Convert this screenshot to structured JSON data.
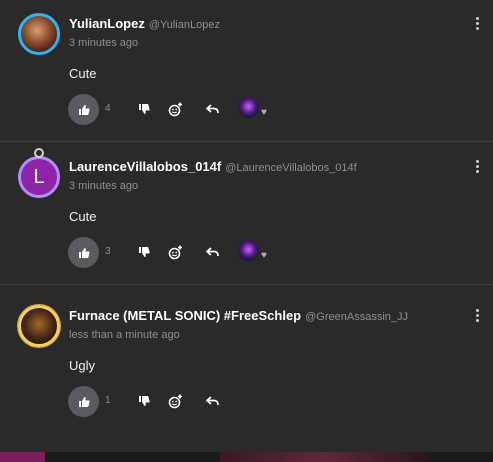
{
  "comments": [
    {
      "name": "YulianLopez",
      "handle": "@YulianLopez",
      "time": "3 minutes ago",
      "text": "Cute",
      "likes": "4",
      "has_reactor": true
    },
    {
      "name": "LaurenceVillalobos_014f",
      "handle": "@LaurenceVillalobos_014f",
      "time": "3 minutes ago",
      "text": "Cute",
      "likes": "3",
      "avatar_letter": "L",
      "has_reactor": true
    },
    {
      "name": "Furnace (METAL SONIC) #FreeSchlep",
      "handle": "@GreenAssassin_JJ",
      "time": "less than a minute ago",
      "text": "Ugly",
      "likes": "1",
      "has_reactor": false
    }
  ],
  "icons": {
    "like": "thumbs-up-icon",
    "dislike": "thumbs-down-icon",
    "emoji": "add-emoji-icon",
    "reply": "reply-icon",
    "more": "kebab-menu-icon",
    "heart": "heart-icon"
  },
  "colors": {
    "background": "#2a2a2b",
    "divider": "#3c3c3e",
    "like_button": "#5a5a62",
    "muted_text": "#8f8f95"
  }
}
